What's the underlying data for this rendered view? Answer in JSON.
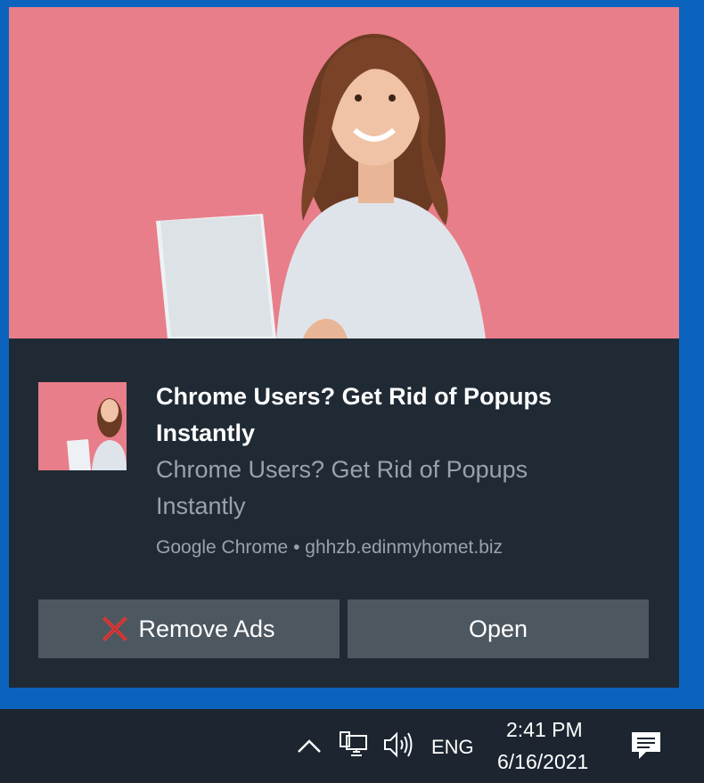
{
  "toast": {
    "title": "Chrome Users? Get Rid of Popups Instantly",
    "message": "Chrome Users? Get Rid of Popups Instantly",
    "attribution": "Google Chrome • ghhzb.edinmyhomet.biz",
    "buttons": {
      "remove_ads": "Remove Ads",
      "open": "Open"
    },
    "hero_image": "woman-with-laptop-on-pink-background",
    "colors": {
      "hero_bg": "#e87e89",
      "toast_bg": "#1f2a35",
      "button_bg": "#4d5760",
      "close_icon": "#e53935"
    }
  },
  "taskbar": {
    "icons": [
      "chevron-up-icon",
      "network-icon",
      "speaker-icon",
      "notification-icon"
    ],
    "language": "ENG",
    "time": "2:41 PM",
    "date": "6/16/2021"
  }
}
